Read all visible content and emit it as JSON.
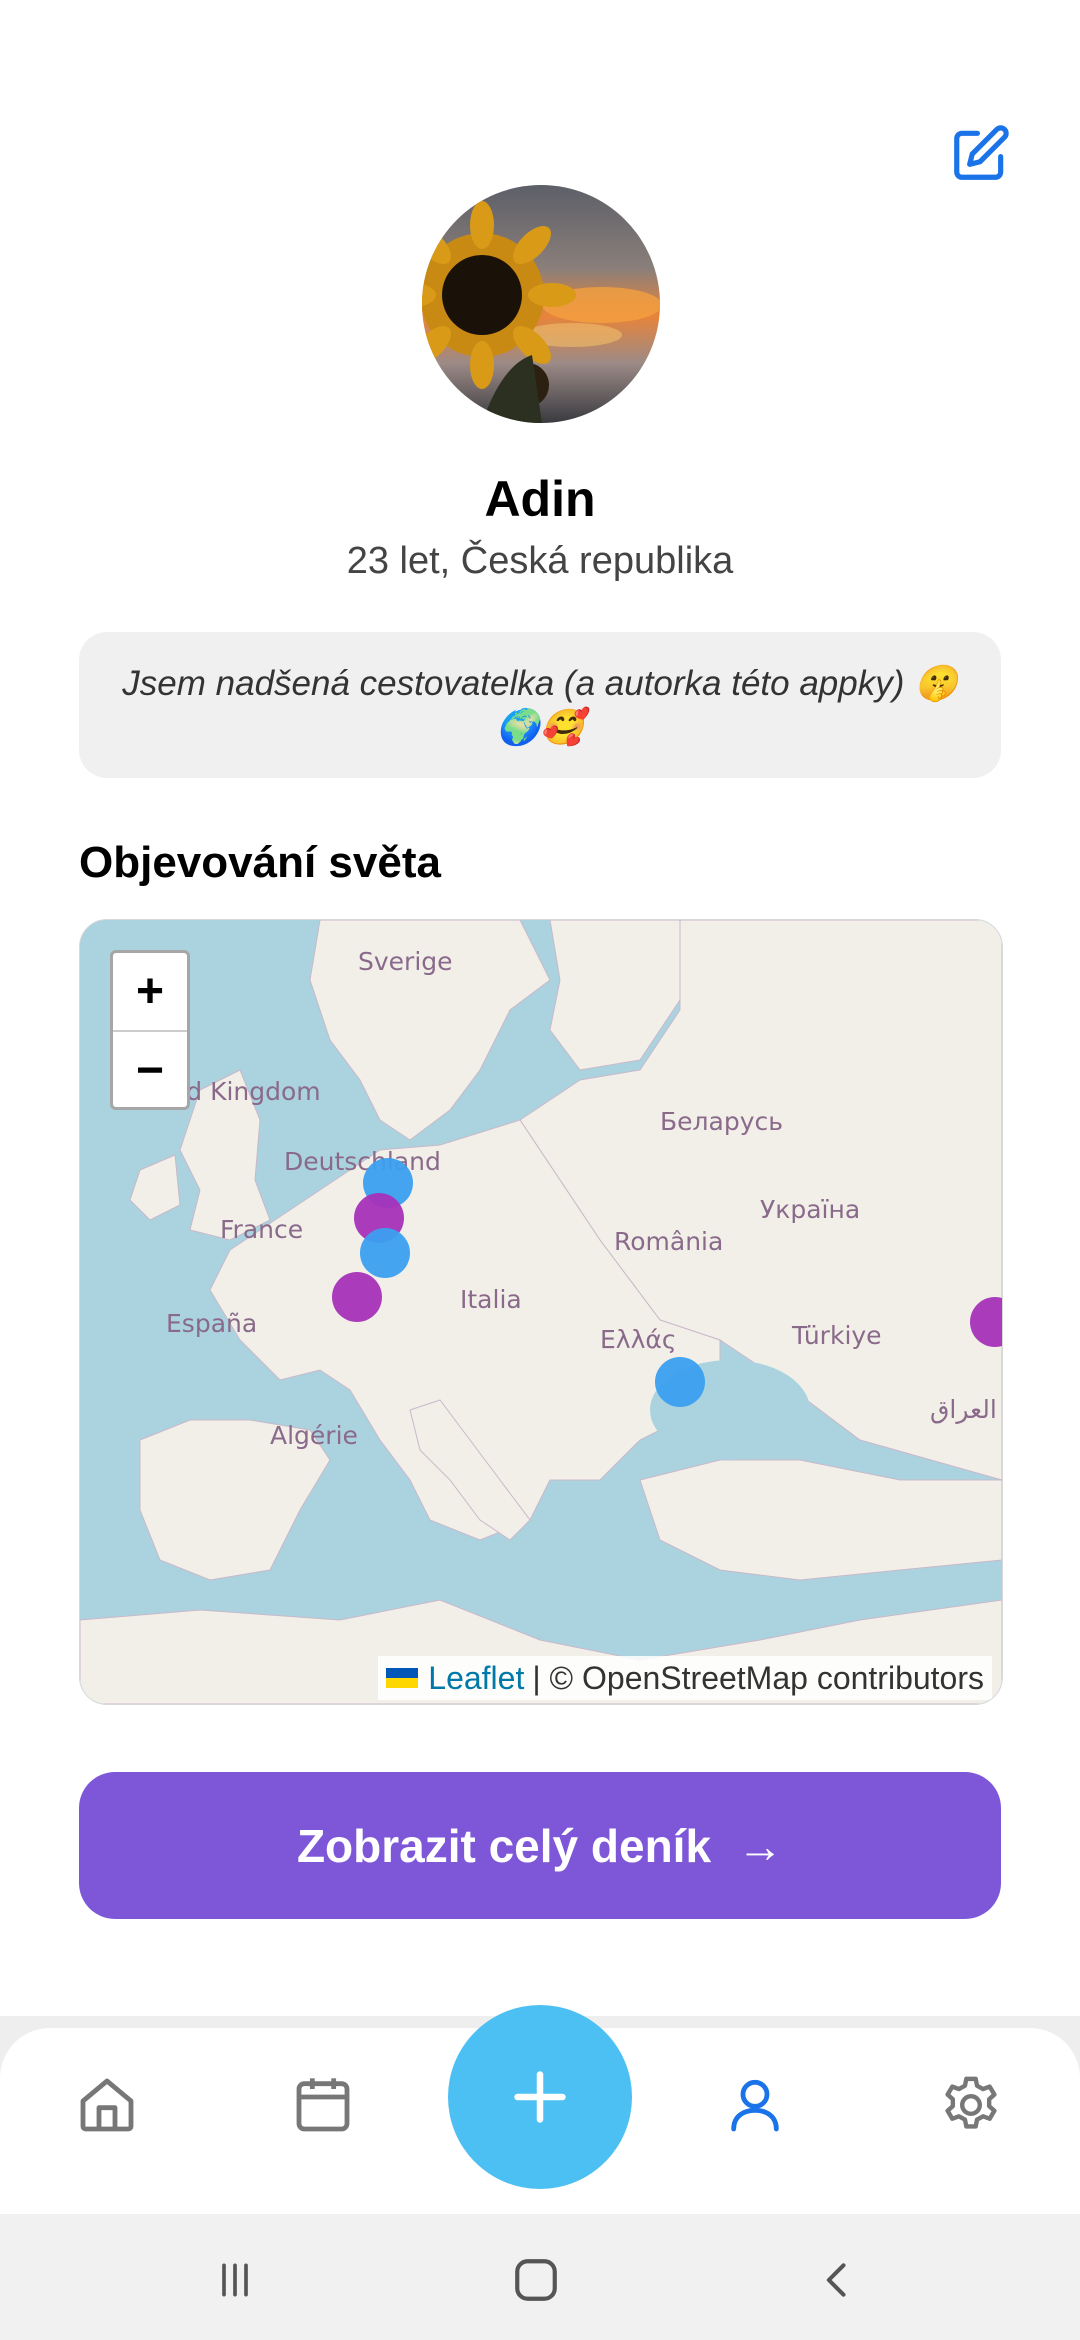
{
  "profile": {
    "name": "Adin",
    "meta": "23 let, Česká republika",
    "bio": "Jsem  nadšená cestovatelka (a autorka této appky) 🤫🌍🥰"
  },
  "section": {
    "title": "Objevování světa"
  },
  "map": {
    "zoom_in": "+",
    "zoom_out": "−",
    "labels": {
      "sweden": "Sverige",
      "uk": "United Kingdom",
      "belarus": "Беларусь",
      "germany": "Deutschland",
      "ukraine": "Україна",
      "france": "France",
      "romania": "România",
      "spain": "España",
      "italy": "Italia",
      "greece": "Ελλάς",
      "turkey": "Türkiye",
      "iraq": "العراق",
      "algeria": "Algérie"
    },
    "attribution": {
      "leaflet": "Leaflet",
      "osm": "| © OpenStreetMap contributors"
    },
    "marker_colors": {
      "blue": "#3b9ff0",
      "purple": "#a532b8"
    }
  },
  "cta": {
    "label": "Zobrazit celý deník",
    "arrow": "→"
  },
  "nav": {
    "items": [
      "home-icon",
      "calendar-icon",
      "add-icon",
      "profile-icon",
      "settings-icon"
    ],
    "active": "profile-icon"
  },
  "colors": {
    "accent": "#7e57d9",
    "fab": "#4cbff3",
    "active_nav": "#1a73e8"
  }
}
